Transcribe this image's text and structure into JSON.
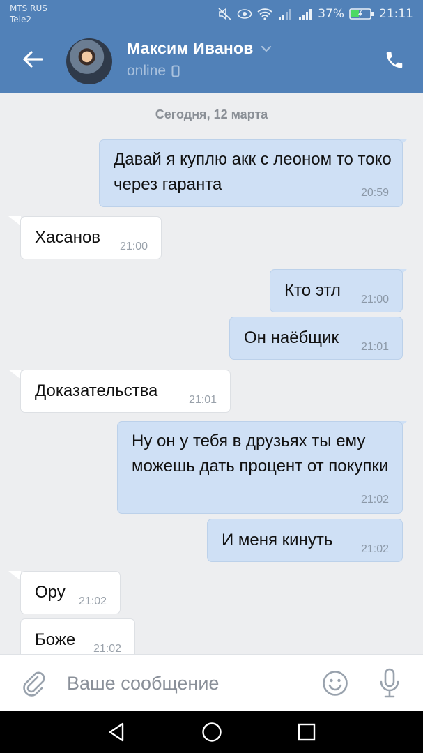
{
  "status_bar": {
    "carrier1": "MTS RUS",
    "carrier2": "Tele2",
    "battery": "37%",
    "time": "21:11"
  },
  "header": {
    "contact_name": "Максим Иванов",
    "presence": "online"
  },
  "chat": {
    "date_divider": "Сегодня, 12 марта",
    "messages": [
      {
        "dir": "out",
        "text": "Давай я куплю акк с леоном то токо через гаранта",
        "time": "20:59"
      },
      {
        "dir": "in",
        "text": "Хасанов",
        "time": "21:00"
      },
      {
        "dir": "out",
        "text": "Кто этл",
        "time": "21:00"
      },
      {
        "dir": "out",
        "text": "Он наёбщик",
        "time": "21:01"
      },
      {
        "dir": "in",
        "text": "Доказательства",
        "time": "21:01"
      },
      {
        "dir": "out",
        "text": "Ну он у тебя в друзьях ты ему можешь дать процент от покупки",
        "time": "21:02"
      },
      {
        "dir": "out",
        "text": "И меня кинуть",
        "time": "21:02"
      },
      {
        "dir": "in",
        "text": "Ору",
        "time": "21:02"
      },
      {
        "dir": "in",
        "text": "Боже",
        "time": "21:02"
      }
    ]
  },
  "composer": {
    "placeholder": "Ваше сообщение"
  },
  "colors": {
    "header_bg": "#5181b8",
    "outgoing_bubble": "#cfe0f5",
    "incoming_bubble": "#ffffff",
    "chat_bg": "#edeef0"
  },
  "icons": [
    "back-arrow-icon",
    "chevron-down-icon",
    "mobile-icon",
    "phone-icon",
    "paperclip-icon",
    "emoji-icon",
    "microphone-icon",
    "nav-back-icon",
    "nav-home-icon",
    "nav-recents-icon"
  ]
}
